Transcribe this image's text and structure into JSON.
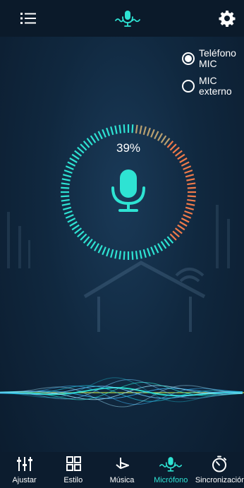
{
  "colors": {
    "accent": "#2ee3d3",
    "ring_low": "#f07a4a",
    "background": "#10283f",
    "bar": "#0b1a2a"
  },
  "header": {
    "menu_icon": "list-icon",
    "center_icon": "microphone-wave-icon",
    "settings_icon": "gear-icon"
  },
  "mic_source": {
    "selected": "telefono",
    "options": [
      {
        "id": "telefono",
        "label_line1": "Teléfono",
        "label_line2": "MIC",
        "checked": true
      },
      {
        "id": "externo",
        "label_line1": "MIC",
        "label_line2": "externo",
        "checked": false
      }
    ]
  },
  "level": {
    "percent_text": "39%",
    "fraction": 0.39,
    "icon": "microphone-icon"
  },
  "nav": {
    "items": [
      {
        "label": "Ajustar",
        "icon": "equalizer-sliders-icon",
        "active": false
      },
      {
        "label": "Estilo",
        "icon": "grid-icon",
        "active": false
      },
      {
        "label": "Música",
        "icon": "music-note-icon",
        "active": false
      },
      {
        "label": "Micrófono",
        "icon": "microphone-wave-icon",
        "active": true
      },
      {
        "label": "Sincronización",
        "icon": "stopwatch-icon",
        "active": false
      }
    ]
  }
}
